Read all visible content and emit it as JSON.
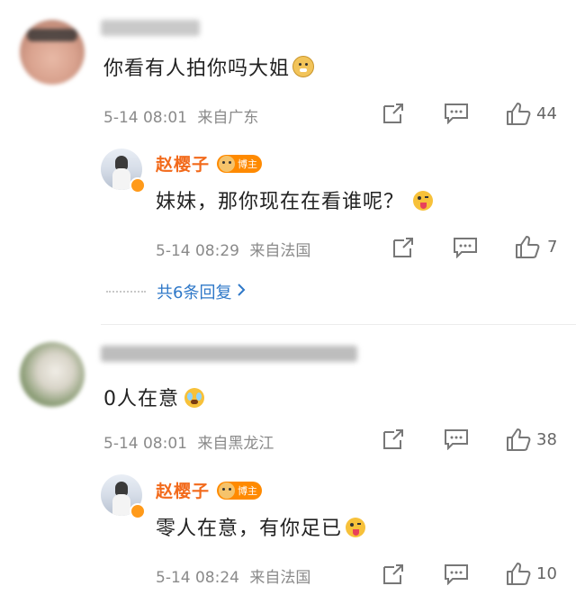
{
  "comments": [
    {
      "text": "你看有人拍你吗大姐",
      "time": "5-14 08:01",
      "location": "来自广东",
      "likes": "44",
      "reply": {
        "author": "赵樱子",
        "badge": "博主",
        "text": "妹妹，那你现在在看谁呢？",
        "time": "5-14 08:29",
        "location": "来自法国",
        "likes": "7"
      },
      "more_replies": "共6条回复"
    },
    {
      "text": "0人在意",
      "time": "5-14 08:01",
      "location": "来自黑龙江",
      "likes": "38",
      "reply": {
        "author": "赵樱子",
        "badge": "博主",
        "text": "零人在意，有你足已",
        "time": "5-14 08:24",
        "location": "来自法国",
        "likes": "10"
      }
    }
  ],
  "icons": [
    "share-icon",
    "comment-icon",
    "like-icon",
    "blogger-dog-icon",
    "chevron-right-icon",
    "doge-emoji-icon",
    "tongue-emoji-icon",
    "tears-emoji-icon"
  ],
  "colors": {
    "accent": "#f26a1b",
    "link": "#2f78c8",
    "meta": "#8a8a8a"
  }
}
